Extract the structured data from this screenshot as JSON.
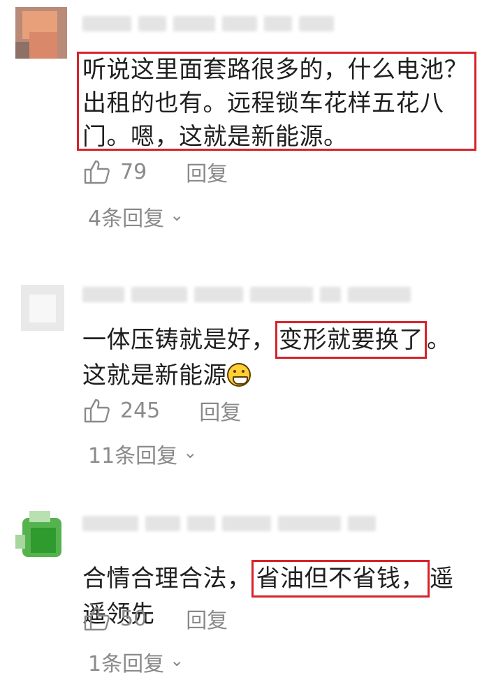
{
  "comments": [
    {
      "text_parts": [
        "听说这里面套路很多的，什么电池？出租的也有。远程锁车花样五花八门。嗯，这就是新能源。"
      ],
      "likes": "79",
      "reply_label": "回复",
      "more_replies": "4条回复",
      "avatar_color": "#e8a07a"
    },
    {
      "text_before": "一体压铸就是好，",
      "text_highlight": "变形就要换了",
      "text_after": "。这就是新能源",
      "emoji": "grinning-face",
      "likes": "245",
      "reply_label": "回复",
      "more_replies": "11条回复",
      "avatar_color": "#dcdcdc"
    },
    {
      "text_before": "合情合理合法，",
      "text_highlight": "省油但不省钱，",
      "text_after": "遥遥领先",
      "likes": "50",
      "reply_label": "回复",
      "more_replies": "1条回复",
      "avatar_color": "#3fa83c"
    }
  ],
  "colors": {
    "highlight_border": "#d7222a",
    "meta_text": "#8a8a8a",
    "body_text": "#1f1f1f"
  }
}
